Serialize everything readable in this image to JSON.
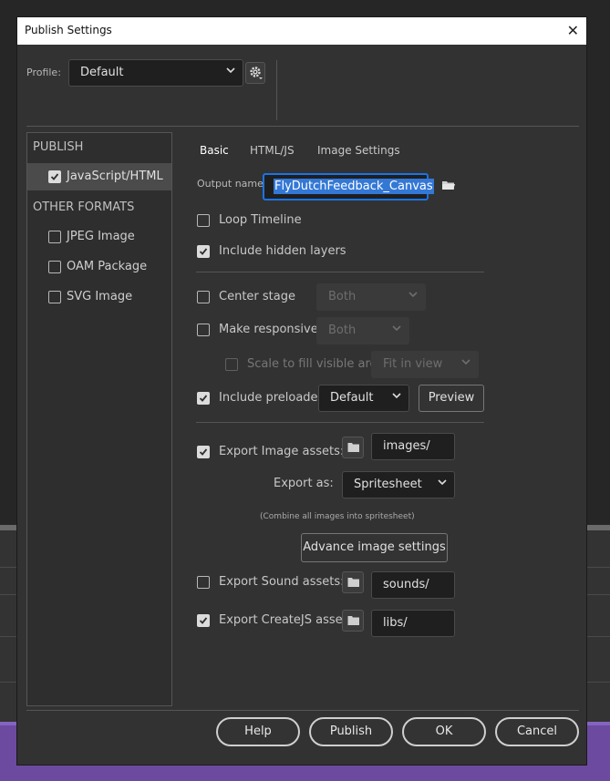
{
  "dialog": {
    "title": "Publish Settings",
    "close_glyph": "✕"
  },
  "profile": {
    "label": "Profile:",
    "value": "Default",
    "settings_icon": "gear-icon"
  },
  "formats": {
    "publish_heading": "PUBLISH",
    "other_heading": "OTHER FORMATS",
    "items": [
      {
        "label": "JavaScript/HTML",
        "checked": true,
        "selected": true
      },
      {
        "label": "JPEG Image",
        "checked": false
      },
      {
        "label": "OAM Package",
        "checked": false
      },
      {
        "label": "SVG Image",
        "checked": false
      }
    ]
  },
  "tabs": [
    {
      "label": "Basic",
      "active": true
    },
    {
      "label": "HTML/JS",
      "active": false
    },
    {
      "label": "Image Settings",
      "active": false
    }
  ],
  "basic": {
    "output_name_label": "Output name:",
    "output_name_value": "FlyDutchFeedback_Canvas",
    "loop_timeline": {
      "label": "Loop Timeline",
      "checked": false
    },
    "include_hidden_layers": {
      "label": "Include hidden layers",
      "checked": true
    },
    "center_stage": {
      "label": "Center stage",
      "checked": false,
      "dropdown": "Both"
    },
    "make_responsive": {
      "label": "Make responsive",
      "checked": false,
      "dropdown": "Both"
    },
    "scale_to_fill": {
      "label": "Scale to fill visible area",
      "checked": false,
      "dropdown": "Fit in view"
    },
    "include_preloader": {
      "label": "Include preloader",
      "checked": true,
      "dropdown": "Default",
      "preview_label": "Preview"
    },
    "export_image_assets": {
      "label": "Export Image assets:",
      "checked": true,
      "path": "images/"
    },
    "export_as": {
      "label": "Export as:",
      "value": "Spritesheet",
      "note": "(Combine all images into spritesheet)"
    },
    "advance_image_settings_label": "Advance image settings",
    "export_sound_assets": {
      "label": "Export Sound assets:",
      "checked": false,
      "path": "sounds/"
    },
    "export_createjs_assets": {
      "label": "Export CreateJS assets:",
      "checked": true,
      "path": "libs/"
    }
  },
  "buttons": {
    "help": "Help",
    "publish": "Publish",
    "ok": "OK",
    "cancel": "Cancel"
  },
  "colors": {
    "dialog_bg": "#323232",
    "focus_blue": "#1a73e8",
    "selection_blue": "#3478d6"
  }
}
